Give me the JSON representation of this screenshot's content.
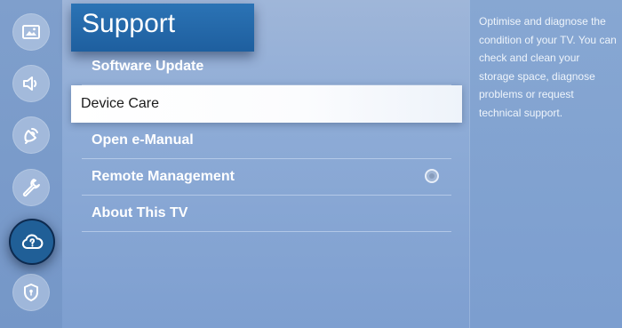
{
  "rail": {
    "icons": [
      {
        "name": "picture-icon",
        "active": false
      },
      {
        "name": "sound-icon",
        "active": false
      },
      {
        "name": "broadcasting-icon",
        "active": false
      },
      {
        "name": "general-tools-icon",
        "active": false
      },
      {
        "name": "support-cloud-icon",
        "active": true
      },
      {
        "name": "privacy-shield-icon",
        "active": false
      }
    ]
  },
  "panel": {
    "title": "Support",
    "items": [
      {
        "label": "Software Update",
        "focused": false
      },
      {
        "label": "Device Care",
        "focused": true
      },
      {
        "label": "Open e-Manual",
        "focused": false
      },
      {
        "label": "Remote Management",
        "focused": false,
        "has_radio": true
      },
      {
        "label": "About This TV",
        "focused": false
      }
    ]
  },
  "description": {
    "text": "Optimise and diagnose the\ncondition of your TV. You can\ncheck and clean your\nstorage space, diagnose\nproblems or request\ntechnical support."
  },
  "colors": {
    "accent": "#2b73b5",
    "active_icon": "#205f97",
    "focus_bg": "#ffffff"
  }
}
